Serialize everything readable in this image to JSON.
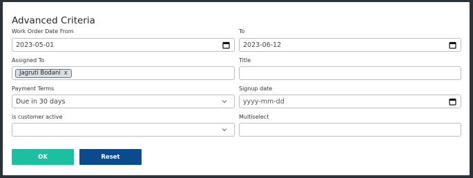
{
  "form": {
    "title": "Advanced Criteria",
    "work_order_date_from": {
      "label": "Work Order Date From",
      "value": "2023-05-01",
      "icon": "calendar-icon"
    },
    "work_order_date_to": {
      "label": "To",
      "value": "2023-06-12",
      "icon": "calendar-icon"
    },
    "assigned_to": {
      "label": "Assigned To",
      "chips": [
        {
          "text": "Jagruti Bodani",
          "remove": "x"
        }
      ]
    },
    "title_field": {
      "label": "Title",
      "value": ""
    },
    "payment_terms": {
      "label": "Payment Terms",
      "value": "Due in 30 days",
      "icon": "chevron-down-icon"
    },
    "signup_date": {
      "label": "Signup date",
      "placeholder": "yyyy-mm-dd",
      "icon": "calendar-icon"
    },
    "is_customer_active": {
      "label": "is customer active",
      "value": "",
      "icon": "chevron-down-icon"
    },
    "multiselect": {
      "label": "Multiselect",
      "value": ""
    }
  },
  "buttons": {
    "ok": "OK",
    "reset": "Reset"
  },
  "colors": {
    "ok_button": "#1ebea0",
    "reset_button": "#0c4a8e",
    "backdrop": "#2c3338",
    "field_border": "#b8bec4",
    "chip_background": "#d9dde2"
  }
}
